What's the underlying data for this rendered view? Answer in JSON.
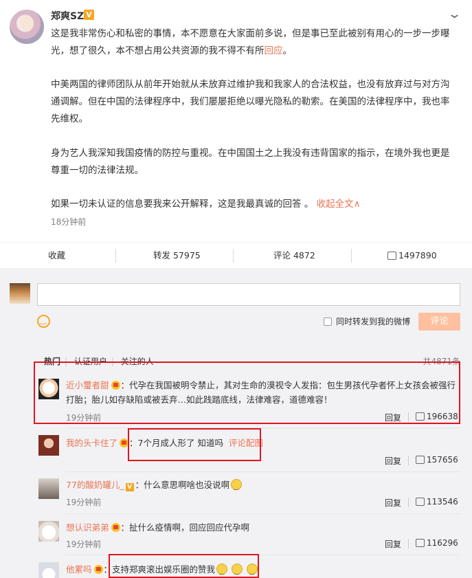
{
  "post": {
    "author": "郑爽SZ",
    "verified_badge": "V",
    "paragraphs": [
      {
        "text": "这是我非常伤心和私密的事情，本不愿意在大家面前多说，但是事已至此被别有用心的一步一步曝光，想了很久，本不想占用公共资源的我不得不有所",
        "link": "回应",
        "tail": "。"
      },
      {
        "text": "中美两国的律师团队从前年开始就从未放弃过维护我和我家人的合法权益，也没有放弃过与对方沟通调解。但在中国的法律程序中，我们屡屡拒绝以曝光隐私的勒索。在美国的法律程序中，我也率先维权。"
      },
      {
        "text": "身为艺人我深知我国疫情的防控与重视。在中国国土之上我没有违背国家的指示，在境外我也更是尊重一切的法律法规。"
      },
      {
        "text": "如果一切未认证的信息要我来公开解释，这是我最真诚的回答 。",
        "link": "收起全文",
        "tail": "∧"
      }
    ],
    "time": "18分钟前"
  },
  "actions": {
    "favorite": "收藏",
    "repost": "转发 57975",
    "comment": "评论 4872",
    "like": "1497890"
  },
  "composer": {
    "forward_label": "同时转发到我的微博",
    "submit": "评论"
  },
  "tabs": {
    "hot": "热门",
    "verified": "认证用户",
    "following": "关注的人",
    "total": "共4871条"
  },
  "comments": [
    {
      "user": "近小璽者甜",
      "badge": "crown",
      "text": "：代孕在我国被明令禁止，其对生命的漠视令人发指：包生男孩代孕者怀上女孩会被强行打胎；胎儿如存缺陷或被丢弃…如此践踏底线，法律难容，道德难容！",
      "time": "19分钟前",
      "reply": "回复",
      "likes": "196638"
    },
    {
      "user": "我的头卡住了",
      "badge": "crown",
      "text": "：7个月成人形了 知道吗",
      "link": "评论配图",
      "time": "19分钟前",
      "reply": "回复",
      "likes": "157656"
    },
    {
      "user": "77的酸奶罐儿_",
      "badge": "v",
      "text": "：什么意思啊啥也没说啊",
      "time": "19分钟前",
      "reply": "回复",
      "likes": "113546"
    },
    {
      "user": "想认识弟弟",
      "badge": "crown",
      "text": "：扯什么疫情啊，回应回应代孕啊",
      "time": "19分钟前",
      "reply": "回复",
      "likes": "116296"
    },
    {
      "user": "他累吗",
      "badge": "crown",
      "text": "：支持郑爽滚出娱乐圈的赞我"
    }
  ],
  "colors": {
    "accent": "#eb7350",
    "highlight_box": "#e0141e",
    "submit_bg": "#ffc09f"
  }
}
